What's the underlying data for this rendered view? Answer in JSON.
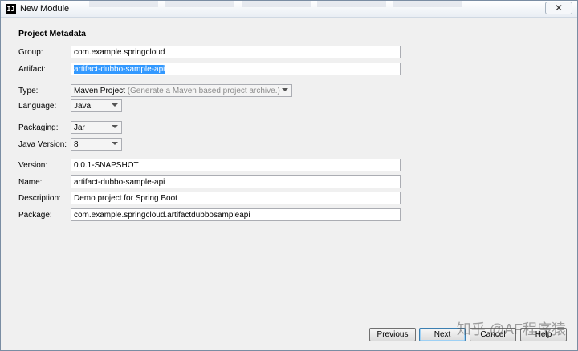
{
  "window": {
    "title": "New Module",
    "close_symbol": "✕"
  },
  "section_title": "Project Metadata",
  "fields": {
    "group": {
      "label": "Group:",
      "value": "com.example.springcloud"
    },
    "artifact": {
      "label": "Artifact:",
      "value": "artifact-dubbo-sample-api"
    },
    "type": {
      "label": "Type:",
      "value": "Maven Project",
      "hint": "(Generate a Maven based project archive.)"
    },
    "language": {
      "label": "Language:",
      "value": "Java"
    },
    "packaging": {
      "label": "Packaging:",
      "value": "Jar"
    },
    "java_version": {
      "label": "Java Version:",
      "value": "8"
    },
    "version": {
      "label": "Version:",
      "value": "0.0.1-SNAPSHOT"
    },
    "name": {
      "label": "Name:",
      "value": "artifact-dubbo-sample-api"
    },
    "description": {
      "label": "Description:",
      "value": "Demo project for Spring Boot"
    },
    "package": {
      "label": "Package:",
      "value": "com.example.springcloud.artifactdubbosampleapi"
    }
  },
  "buttons": {
    "previous": "Previous",
    "next": "Next",
    "cancel": "Cancel",
    "help": "Help"
  },
  "watermark": "知乎 @AF程序猿"
}
